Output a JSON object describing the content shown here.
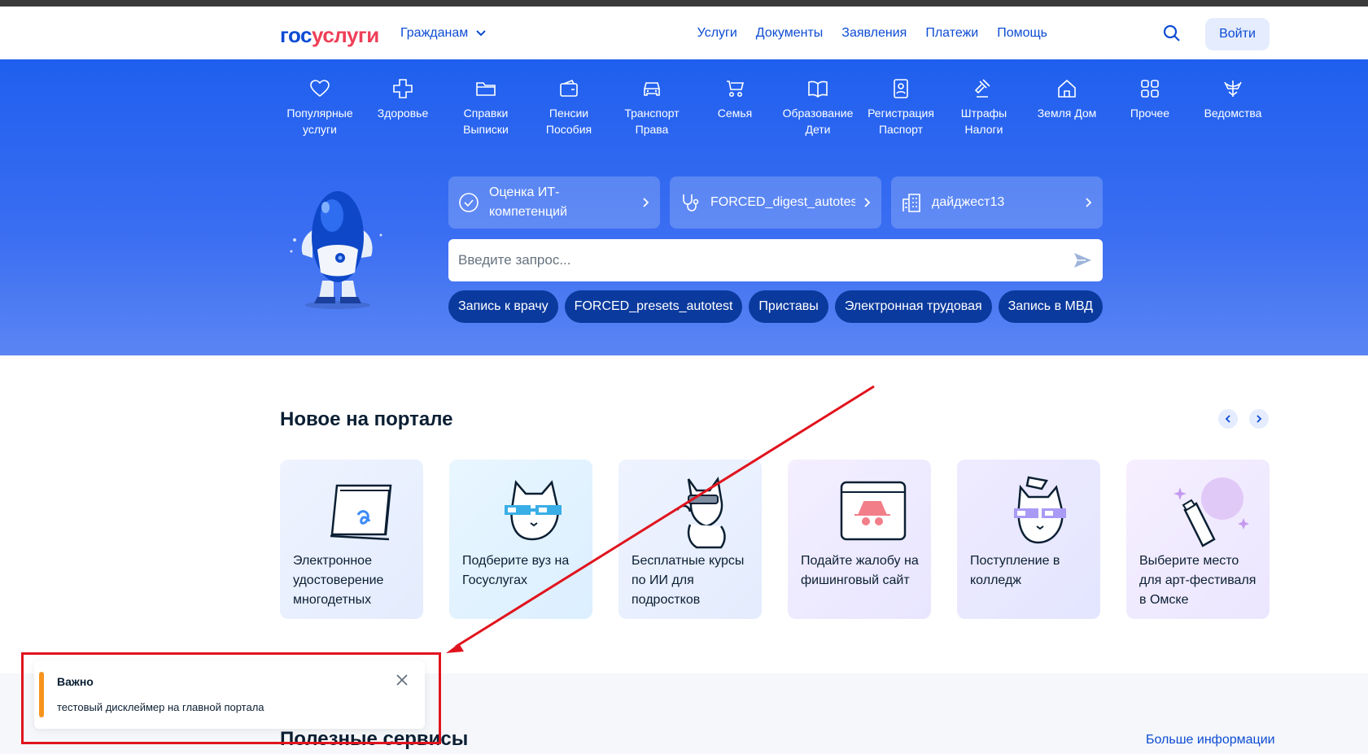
{
  "header": {
    "logo_part1": "гос",
    "logo_part2": "услуги",
    "citizens_label": "Гражданам",
    "nav": [
      "Услуги",
      "Документы",
      "Заявления",
      "Платежи",
      "Помощь"
    ],
    "login_label": "Войти"
  },
  "categories": [
    {
      "label": "Популярные услуги",
      "icon": "heart-icon"
    },
    {
      "label": "Здоровье",
      "icon": "medical-cross-icon"
    },
    {
      "label": "Справки Выписки",
      "icon": "folder-icon"
    },
    {
      "label": "Пенсии Пособия",
      "icon": "wallet-icon"
    },
    {
      "label": "Транспорт Права",
      "icon": "car-icon"
    },
    {
      "label": "Семья",
      "icon": "stroller-icon"
    },
    {
      "label": "Образование Дети",
      "icon": "book-icon"
    },
    {
      "label": "Регистрация Паспорт",
      "icon": "id-card-icon"
    },
    {
      "label": "Штрафы Налоги",
      "icon": "gavel-icon"
    },
    {
      "label": "Земля Дом",
      "icon": "house-icon"
    },
    {
      "label": "Прочее",
      "icon": "grid-icon"
    },
    {
      "label": "Ведомства",
      "icon": "emblem-icon"
    }
  ],
  "quick_links": [
    {
      "label": "Оценка ИТ-компетенций",
      "icon": "check-circle-icon"
    },
    {
      "label": "FORCED_digest_autotest",
      "icon": "stethoscope-icon"
    },
    {
      "label": "дайджест13",
      "icon": "building-icon"
    }
  ],
  "search": {
    "placeholder": "Введите запрос..."
  },
  "chips": [
    "Запись к врачу",
    "FORCED_presets_autotest",
    "Приставы",
    "Электронная трудовая",
    "Запись в МВД"
  ],
  "news": {
    "title": "Новое на портале",
    "cards": [
      "Электронное удостоверение многодетных",
      "Подберите вуз на Госуслугах",
      "Бесплатные курсы по ИИ для подростков",
      "Подайте жалобу на фишинговый сайт",
      "Поступление в колледж",
      "Выберите место для арт-фестиваля в Омске"
    ]
  },
  "useful": {
    "title": "Полезные сервисы",
    "more_label": "Больше информации"
  },
  "toast": {
    "title": "Важно",
    "text": "тестовый дисклеймер на главной портала"
  },
  "colors": {
    "brand_blue": "#0d4cd3",
    "brand_red": "#ee3f58",
    "hero": "#2a63ef",
    "annotation": "#e0141e",
    "toast_accent": "#f7941d"
  }
}
